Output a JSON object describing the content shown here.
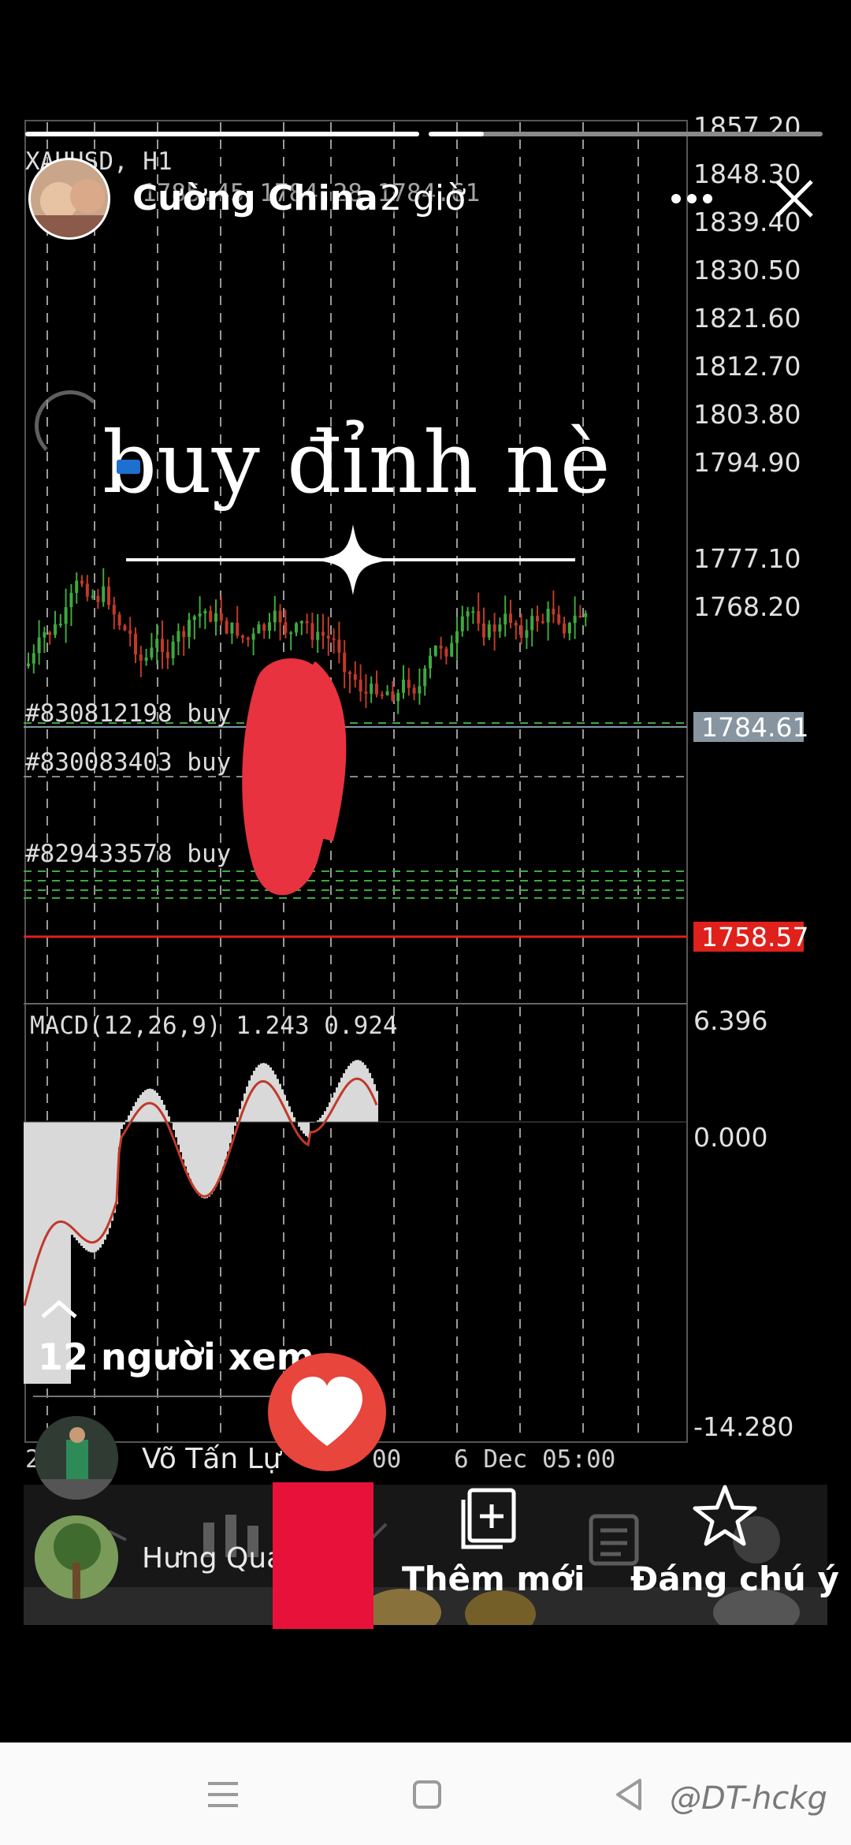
{
  "story": {
    "author": "Cường China",
    "time": "2 giờ",
    "overlay_text": "buy đỉnh nè",
    "viewers_label": "12 người xem",
    "viewers": [
      {
        "name": "Võ Tấn Lự"
      },
      {
        "name": "Hưng Qua"
      }
    ],
    "actions": {
      "add_new": "Thêm mới",
      "highlight": "Đáng chú ý"
    }
  },
  "mt4": {
    "symbol": "XAUUSD, H1",
    "ohlc": "1785.45 1784.28 1784.61",
    "price_ticks": [
      "1857.20",
      "1848.30",
      "1839.40",
      "1830.50",
      "1821.60",
      "1812.70",
      "1803.80",
      "1794.90",
      "1777.10",
      "1768.20"
    ],
    "current_price": "1784.61",
    "alert_price": "1758.57",
    "orders": [
      "#830812198 buy",
      "#830083403 buy",
      "#829433578 buy"
    ],
    "macd_label": "MACD(12,26,9) 1.243 0.924",
    "macd_ticks": [
      "6.396",
      "0.000",
      "-14.280"
    ],
    "time_labels": [
      "2",
      "00",
      "6 Dec 05:00"
    ],
    "toolbar_icons": [
      "trend-icon",
      "candles-icon",
      "indicator-icon",
      "news-icon",
      "chat-icon"
    ]
  },
  "watermark": "@DT-hckg",
  "colors": {
    "bull": "#3ea93e",
    "bear": "#c0392b",
    "alert": "#e0201b",
    "price_box": "#8795a1",
    "macd_fill": "#d9d9d9",
    "like": "#e8453c",
    "redaction": "#e8323f"
  }
}
